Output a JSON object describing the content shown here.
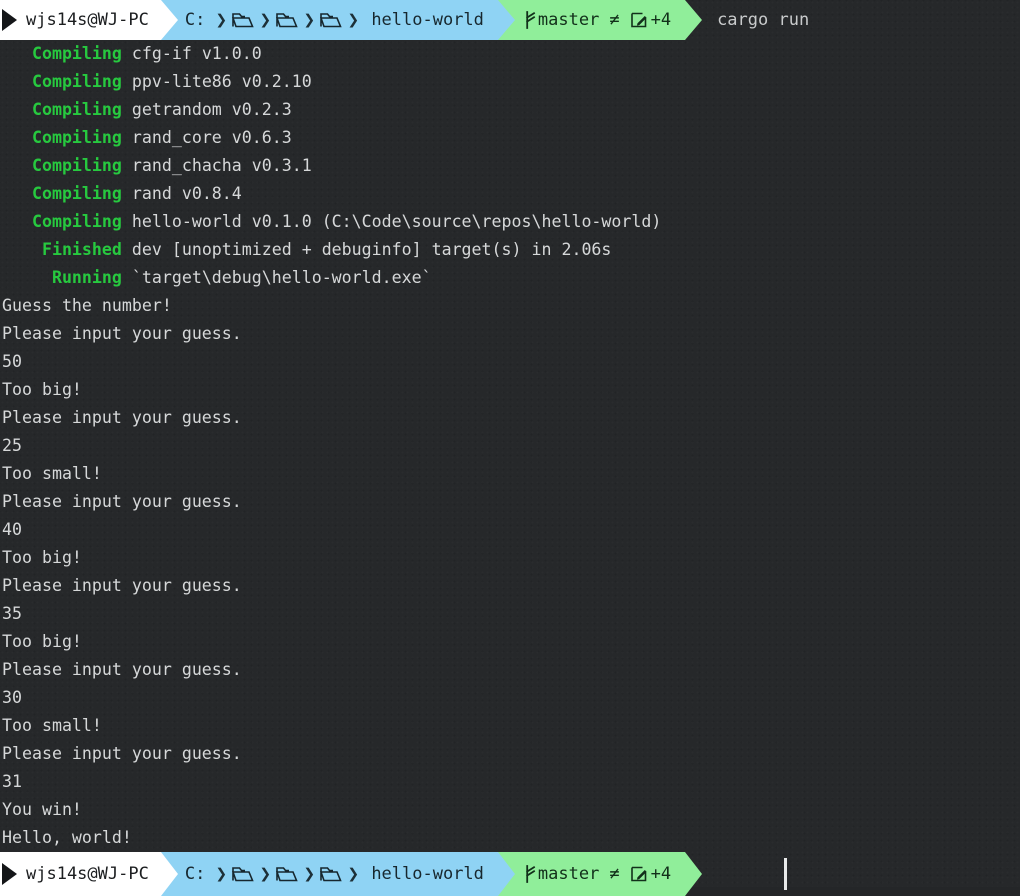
{
  "terminal": {
    "background_color": "#26282a",
    "text_color": "#d6d8d9",
    "accent_green": "#27c93f",
    "prompt_host_bg": "#ffffff",
    "prompt_path_bg": "#8fd3f4",
    "prompt_git_bg": "#90ee9a"
  },
  "prompt_top": {
    "host": "wjs14s@WJ-PC",
    "drive": "C:",
    "folder_icon_1": "folder-icon",
    "folder_icon_2": "folder-icon",
    "folder_icon_3": "folder-icon",
    "chevron": "❯",
    "dirname": "hello-world",
    "branch_icon": "git-branch-icon",
    "branch": "master",
    "dirty_marker": "≠",
    "edit_icon": "pencil-edit-icon",
    "ahead_count": "+4",
    "command": "cargo run"
  },
  "prompt_bottom": {
    "host": "wjs14s@WJ-PC",
    "drive": "C:",
    "chevron": "❯",
    "dirname": "hello-world",
    "branch": "master",
    "dirty_marker": "≠",
    "ahead_count": "+4",
    "command": ""
  },
  "output": {
    "build_lines": [
      {
        "key": "   Compiling",
        "text": " cfg-if v1.0.0"
      },
      {
        "key": "   Compiling",
        "text": " ppv-lite86 v0.2.10"
      },
      {
        "key": "   Compiling",
        "text": " getrandom v0.2.3"
      },
      {
        "key": "   Compiling",
        "text": " rand_core v0.6.3"
      },
      {
        "key": "   Compiling",
        "text": " rand_chacha v0.3.1"
      },
      {
        "key": "   Compiling",
        "text": " rand v0.8.4"
      },
      {
        "key": "   Compiling",
        "text": " hello-world v0.1.0 (C:\\Code\\source\\repos\\hello-world)"
      },
      {
        "key": "    Finished",
        "text": " dev [unoptimized + debuginfo] target(s) in 2.06s"
      },
      {
        "key": "     Running",
        "text": " `target\\debug\\hello-world.exe`"
      }
    ],
    "program_lines": [
      "Guess the number!",
      "Please input your guess.",
      "50",
      "Too big!",
      "Please input your guess.",
      "25",
      "Too small!",
      "Please input your guess.",
      "40",
      "Too big!",
      "Please input your guess.",
      "35",
      "Too big!",
      "Please input your guess.",
      "30",
      "Too small!",
      "Please input your guess.",
      "31",
      "You win!",
      "Hello, world!"
    ]
  }
}
